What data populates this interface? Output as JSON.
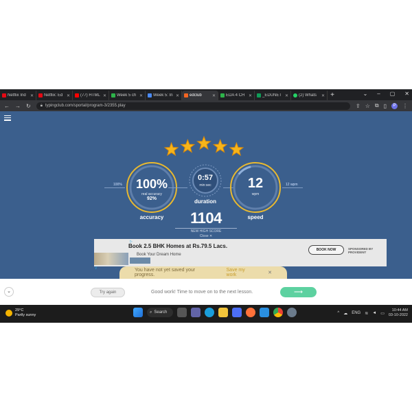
{
  "tabs": [
    {
      "title": "Netflix Ind",
      "color": "#e50914"
    },
    {
      "title": "Netflix: Ed",
      "color": "#e50914"
    },
    {
      "title": "(77) HTML",
      "color": "#ff0000"
    },
    {
      "title": "Week 5 ch",
      "color": "#2db34a"
    },
    {
      "title": "Week 5: In",
      "color": "#4a8af4"
    },
    {
      "title": "edclub",
      "color": "#f26522"
    },
    {
      "title": "EDA 4 CH",
      "color": "#2db34a"
    },
    {
      "title": "_EDUNET",
      "color": "#0f9d58"
    },
    {
      "title": "(2) Whats",
      "color": "#25d366"
    }
  ],
  "new_tab_label": "+",
  "address": {
    "url": "typingclub.com/sportal/program-3/2355.play"
  },
  "profile_initial": "P",
  "stars_count": 5,
  "accuracy": {
    "value": "100%",
    "real_accuracy_label": "real accuracy",
    "real_accuracy_value": "92%",
    "label": "accuracy",
    "side_value": "100%"
  },
  "duration": {
    "value": "0:57",
    "sub": "min:sec",
    "label": "duration"
  },
  "speed": {
    "value": "12",
    "unit": "wpm",
    "label": "speed",
    "side_value": "12 wpm",
    "fraction": 0.12
  },
  "wpm_block": {
    "value": "1104",
    "sub": "NEW HIGH SCORE",
    "close": "Close ✕"
  },
  "ad": {
    "title": "Book 2.5 BHK Homes at Rs.79.5 Lacs.",
    "subtitle": "Book Your Dream Home",
    "button": "BOOK NOW",
    "sponsored": "SPONSORED BY PROVIDENT"
  },
  "notice": {
    "text": "You have not yet saved your progress.",
    "link": "Save my work",
    "close": "✕"
  },
  "bottom": {
    "try_again": "Try again",
    "message": "Good work! Time to move on to the next lesson.",
    "next_arrow": "⟶"
  },
  "weather": {
    "temp": "29°C",
    "desc": "Partly sunny"
  },
  "taskbar": {
    "search": "Search"
  },
  "tray": {
    "lang": "ENG",
    "time": "10:44 AM",
    "date": "03-10-2022"
  }
}
